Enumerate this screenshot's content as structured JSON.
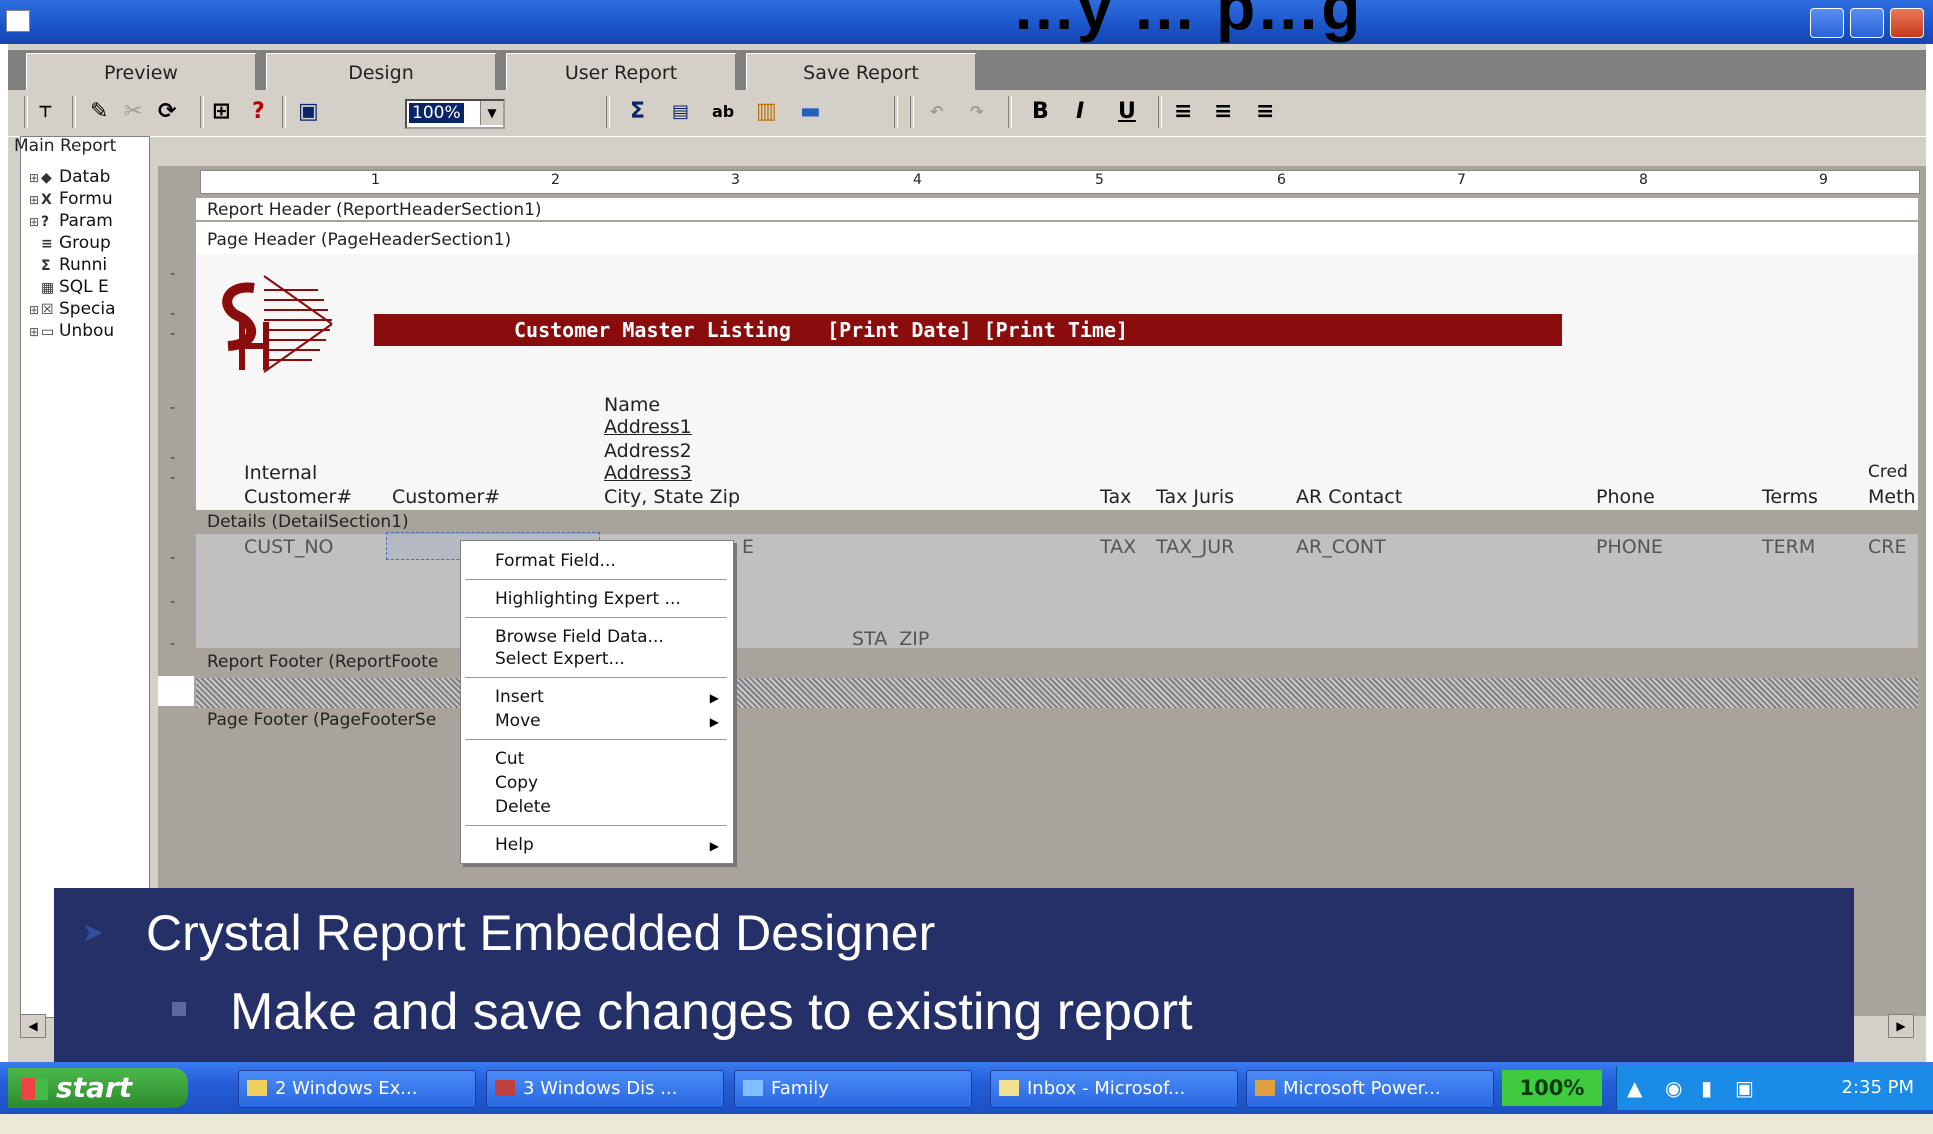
{
  "title_text": "…y … p…g",
  "tabs": [
    "Preview",
    "Design",
    "User Report",
    "Save Report"
  ],
  "toolbar": {
    "zoom": "100%",
    "bold": "B",
    "italic": "I",
    "underline": "U",
    "help": "?",
    "sum": "Σ"
  },
  "tree": {
    "title": "Main Report",
    "items": [
      "Datab",
      "Formu",
      "Param",
      "Group",
      "Runni",
      "SQL E",
      "Specia",
      "Unbou"
    ]
  },
  "ruler": [
    "1",
    "2",
    "3",
    "4",
    "5",
    "6",
    "7",
    "8",
    "9"
  ],
  "sections": {
    "report_header": "Report Header (ReportHeaderSection1)",
    "page_header": "Page Header (PageHeaderSection1)",
    "details": "Details (DetailSection1)",
    "report_footer": "Report Footer (ReportFoote",
    "page_footer": "Page Footer (PageFooterSe"
  },
  "header_bar": "Customer Master Listing   [Print Date] [Print Time]",
  "column_heads": {
    "internal": "Internal",
    "customer_no_a": "Customer#",
    "customer_no_b": "Customer#",
    "name": "Name",
    "address1": "Address1",
    "address2": "Address2",
    "address3": "Address3",
    "city": "City, State Zip",
    "tax": "Tax",
    "tax_juris": "Tax Juris",
    "ar_contact": "AR Contact",
    "phone": "Phone",
    "terms": "Terms",
    "cred_a": "Cred",
    "cred_b": "Meth"
  },
  "detail_fields": {
    "cust_no": "CUST_NO",
    "e_frag": "E",
    "tax": "TAX",
    "tax_jur": "TAX_JUR",
    "ar_cont": "AR_CONT",
    "phone": "PHONE",
    "term": "TERM",
    "cre": "CRE",
    "sta_zip": "STA  ZIP"
  },
  "context_menu": {
    "format_field": "Format Field...",
    "highlighting": "Highlighting Expert ...",
    "browse": "Browse Field Data...",
    "select": "Select Expert...",
    "insert": "Insert",
    "move": "Move",
    "cut": "Cut",
    "copy": "Copy",
    "delete": "Delete",
    "help": "Help"
  },
  "caption": {
    "line1": "Crystal Report Embedded Designer",
    "line2": "Make and save changes to existing report"
  },
  "taskbar": {
    "start": "start",
    "tasks": [
      "2 Windows Ex...",
      "3 Windows Dis ...",
      "Family",
      "Inbox - Microsof...",
      "Microsoft Power..."
    ],
    "percent": "100%",
    "clock": "2:35 PM"
  },
  "colors": {
    "title_blue": "#2f6fe0",
    "header_red": "#8b0c0c",
    "caption_navy": "#263068",
    "taskbar_blue": "#245ed8",
    "start_green": "#3a9e3a"
  }
}
